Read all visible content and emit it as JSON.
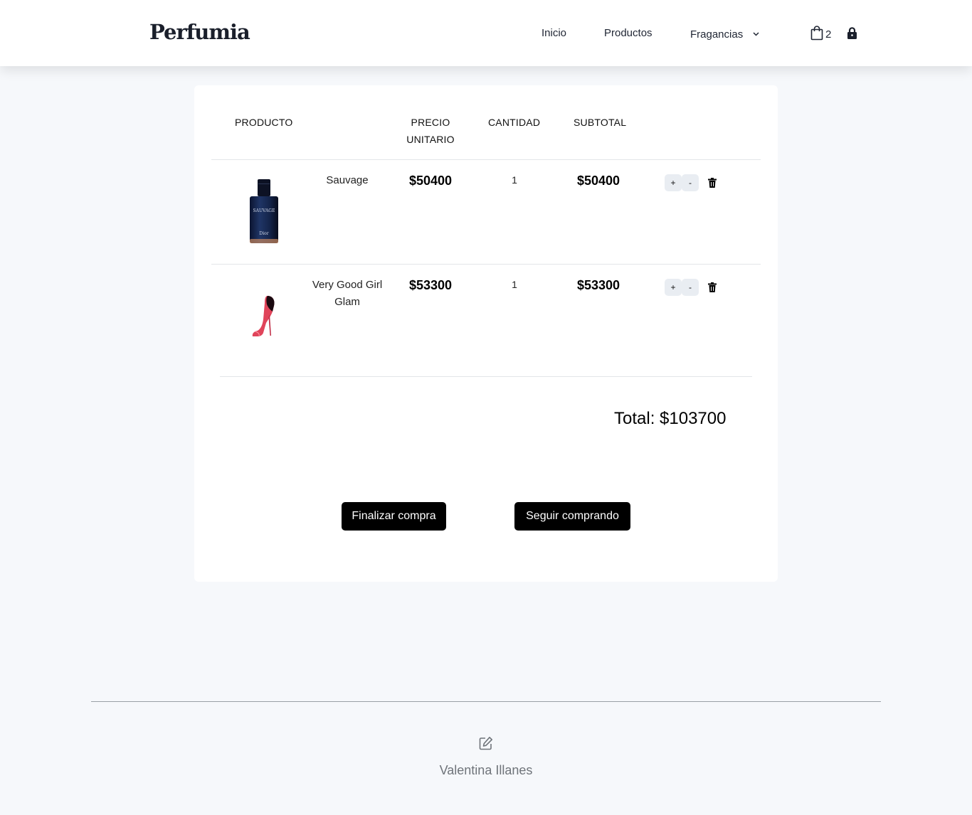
{
  "nav": {
    "brand": "Perfumia",
    "links": [
      "Inicio",
      "Productos",
      "Fragancias"
    ],
    "cart_count": "2",
    "icons": {
      "dropdown": "chevron-down-icon",
      "cart": "shopping-bag-icon",
      "login": "lock-icon"
    }
  },
  "cart": {
    "headers": {
      "producto": "PRODUCTO",
      "precio_line1": "PRECIO",
      "precio_line2": "UNITARIO",
      "cantidad": "CANTIDAD",
      "subtotal": "SUBTOTAL"
    },
    "items": [
      {
        "name": "Sauvage",
        "price": "$50400",
        "qty": "1",
        "subtotal": "$50400",
        "plus": "+",
        "minus": "-",
        "bottle_text": "SAUVAGE",
        "bottle_brand": "Dior"
      },
      {
        "name_line1": "Very Good Girl",
        "name_line2": "Glam",
        "price": "$53300",
        "qty": "1",
        "subtotal": "$53300",
        "plus": "+",
        "minus": "-"
      }
    ],
    "total": "Total: $103700",
    "buttons": {
      "finalizar": "Finalizar compra",
      "seguir": "Seguir comprando"
    }
  },
  "footer": {
    "author": "Valentina Illanes",
    "icon": "edit-icon"
  }
}
